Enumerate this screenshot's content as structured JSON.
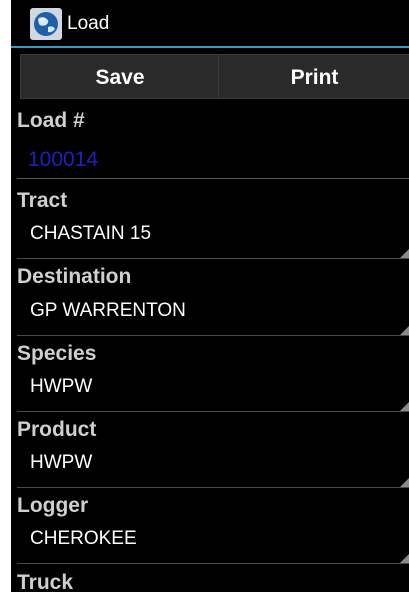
{
  "titlebar": {
    "title": "Load",
    "icon": "globe-icon",
    "accent_color": "#3a98c4"
  },
  "toolbar": {
    "save_label": "Save",
    "print_label": "Print"
  },
  "form": {
    "load_label": "Load #",
    "load_value": "100014",
    "load_value_color": "#2020c0",
    "tract_label": "Tract",
    "tract_value": "CHASTAIN 15",
    "destination_label": "Destination",
    "destination_value": "GP WARRENTON",
    "species_label": "Species",
    "species_value": "HWPW",
    "product_label": "Product",
    "product_value": "HWPW",
    "logger_label": "Logger",
    "logger_value": "CHEROKEE",
    "truck_label": "Truck"
  }
}
